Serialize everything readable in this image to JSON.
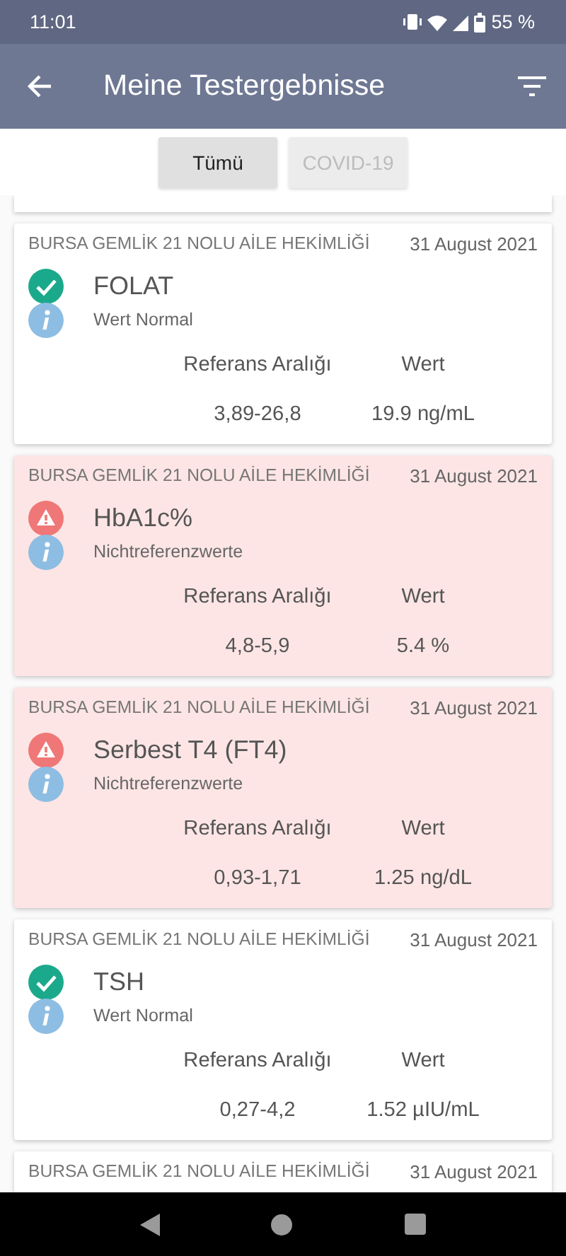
{
  "status_bar": {
    "time": "11:01",
    "battery": "55 %"
  },
  "app_bar": {
    "title": "Meine Testergebnisse"
  },
  "filters": [
    {
      "label": "Tümü",
      "selected": true
    },
    {
      "label": "COVID-19",
      "selected": false
    }
  ],
  "results": [
    {
      "kind": "normal",
      "clinic": "BURSA GEMLİK 21 NOLU AİLE HEKİMLİĞİ",
      "date": "31 August 2021",
      "test": "FOLAT",
      "status": "Wert Normal",
      "range_label": "Referans Aralığı",
      "value_label": "Wert",
      "range": "3,89-26,8",
      "value": "19.9 ng/mL"
    },
    {
      "kind": "abnormal",
      "clinic": "BURSA GEMLİK 21 NOLU AİLE HEKİMLİĞİ",
      "date": "31 August 2021",
      "test": "HbA1c%",
      "status": "Nichtreferenzwerte",
      "range_label": "Referans Aralığı",
      "value_label": "Wert",
      "range": "4,8-5,9",
      "value": "5.4 %"
    },
    {
      "kind": "abnormal",
      "clinic": "BURSA GEMLİK 21 NOLU AİLE HEKİMLİĞİ",
      "date": "31 August 2021",
      "test": "Serbest T4 (FT4)",
      "status": "Nichtreferenzwerte",
      "range_label": "Referans Aralığı",
      "value_label": "Wert",
      "range": "0,93-1,71",
      "value": "1.25 ng/dL"
    },
    {
      "kind": "normal",
      "clinic": "BURSA GEMLİK 21 NOLU AİLE HEKİMLİĞİ",
      "date": "31 August 2021",
      "test": "TSH",
      "status": "Wert Normal",
      "range_label": "Referans Aralığı",
      "value_label": "Wert",
      "range": "0,27-4,2",
      "value": "1.52 µIU/mL"
    },
    {
      "kind": "normal",
      "clinic": "BURSA GEMLİK 21 NOLU AİLE HEKİMLİĞİ",
      "date": "31 August 2021"
    }
  ]
}
